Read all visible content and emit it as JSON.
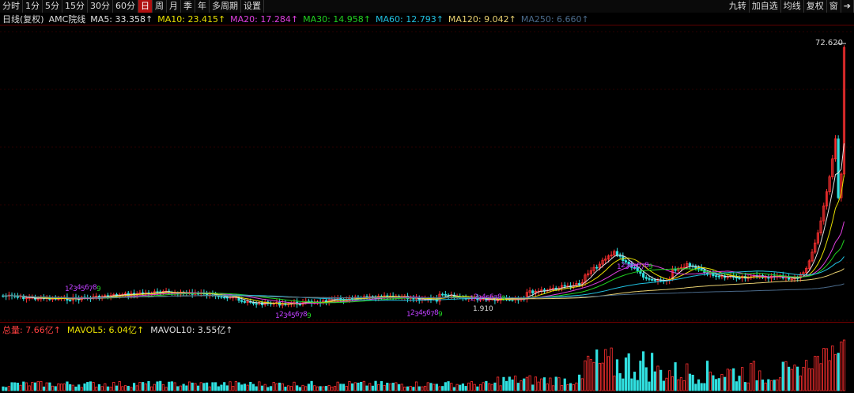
{
  "toolbar": {
    "periods": [
      {
        "label": "分时",
        "active": false
      },
      {
        "label": "1分",
        "active": false
      },
      {
        "label": "5分",
        "active": false
      },
      {
        "label": "15分",
        "active": false
      },
      {
        "label": "30分",
        "active": false
      },
      {
        "label": "60分",
        "active": false
      },
      {
        "label": "日",
        "active": true
      },
      {
        "label": "周",
        "active": false
      },
      {
        "label": "月",
        "active": false
      },
      {
        "label": "季",
        "active": false
      },
      {
        "label": "年",
        "active": false
      },
      {
        "label": "多周期",
        "active": false
      },
      {
        "label": "设置",
        "active": false
      }
    ],
    "right": [
      {
        "label": "九转"
      },
      {
        "label": "加自选"
      },
      {
        "label": "均线"
      },
      {
        "label": "复权"
      },
      {
        "label": "窗"
      },
      {
        "label": "➔"
      }
    ]
  },
  "legend": {
    "title": "日线(复权)",
    "name": "AMC院线",
    "ma": [
      {
        "label": "MA5: 33.358↑",
        "color": "#e0e0e0"
      },
      {
        "label": "MA10: 23.415↑",
        "color": "#e8e000"
      },
      {
        "label": "MA20: 17.284↑",
        "color": "#e040e0"
      },
      {
        "label": "MA30: 14.958↑",
        "color": "#20d020"
      },
      {
        "label": "MA60: 12.793↑",
        "color": "#20c0e0"
      },
      {
        "label": "MA120: 9.042↑",
        "color": "#e8d070"
      },
      {
        "label": "MA250: 6.660↑",
        "color": "#4a6a8a"
      }
    ]
  },
  "price_high": "72.620",
  "price_low_partial": "1.910",
  "nine_turn_labels": [
    {
      "text": "1",
      "color": "#c040ff"
    },
    {
      "text": "2",
      "color": "#c040ff"
    },
    {
      "text": "3",
      "color": "#c040ff"
    },
    {
      "text": "4",
      "color": "#c040ff"
    },
    {
      "text": "5",
      "color": "#c040ff"
    },
    {
      "text": "6",
      "color": "#c040ff"
    },
    {
      "text": "7",
      "color": "#c040ff"
    },
    {
      "text": "8",
      "color": "#c040ff"
    },
    {
      "text": "9",
      "color": "#20d020"
    }
  ],
  "volume": {
    "total": "总量: 7.66亿↑",
    "mavol5": "MAVOL5: 6.04亿↑",
    "mavol10": "MAVOL10: 3.55亿↑",
    "colors": {
      "total": "#ff4040",
      "mavol5": "#e8e000",
      "mavol10": "#e0e0e0"
    }
  }
}
